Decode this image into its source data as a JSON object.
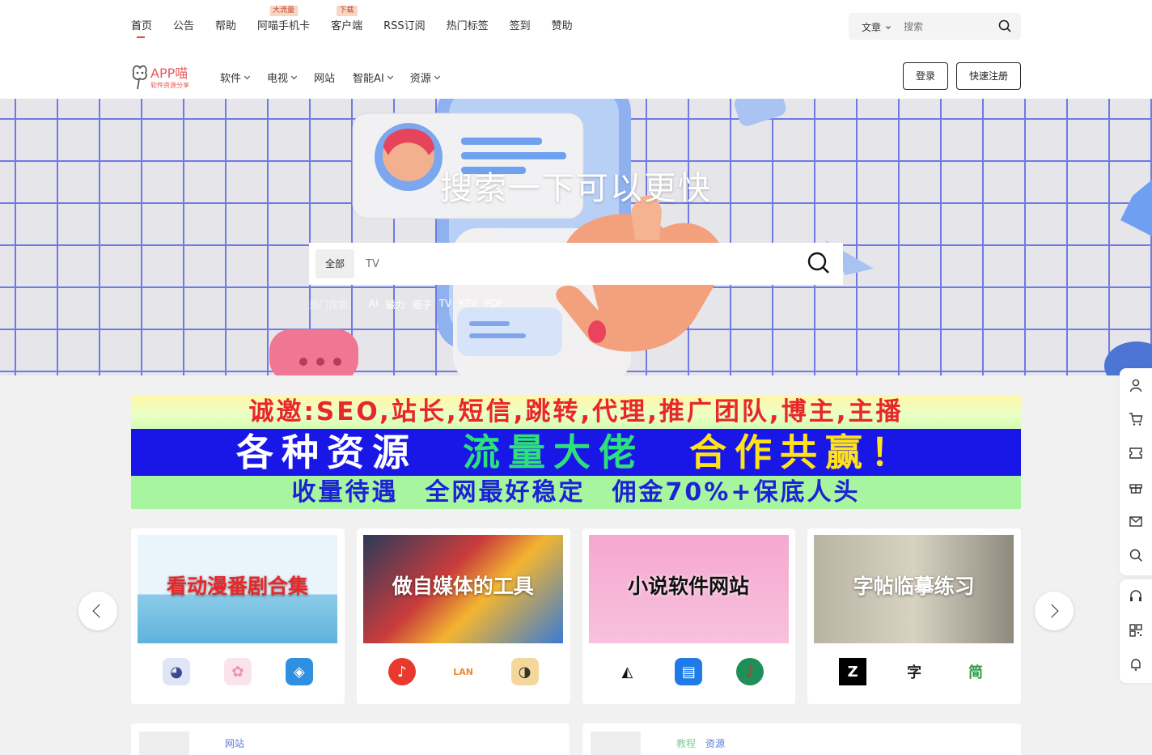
{
  "topnav": {
    "items": [
      {
        "label": "首页",
        "badge": ""
      },
      {
        "label": "公告",
        "badge": ""
      },
      {
        "label": "帮助",
        "badge": ""
      },
      {
        "label": "阿喵手机卡",
        "badge": "大流量"
      },
      {
        "label": "客户端",
        "badge": "下载"
      },
      {
        "label": "RSS订阅",
        "badge": ""
      },
      {
        "label": "热门标签",
        "badge": ""
      },
      {
        "label": "签到",
        "badge": ""
      },
      {
        "label": "赞助",
        "badge": ""
      }
    ],
    "search": {
      "category": "文章",
      "placeholder": "搜索"
    }
  },
  "logo": {
    "text": "APP喵",
    "tagline": "软件资源分享"
  },
  "mainnav": {
    "items": [
      "软件",
      "电视",
      "网站",
      "智能AI",
      "资源"
    ]
  },
  "auth": {
    "login": "登录",
    "register": "快速注册"
  },
  "hero": {
    "title": "搜索一下可以更快",
    "category": "全部",
    "placeholder": "TV",
    "hot_label": "热门搜索：",
    "hot_tags": [
      "AI",
      "磁力",
      "圈子",
      "TV",
      "KTV",
      "PDF"
    ]
  },
  "banner": {
    "line1": "诚邀:SEO,站长,短信,跳转,代理,推广团队,博主,主播",
    "line2a": "各种资源",
    "line2b": "流量大佬",
    "line2c": "合作共赢！",
    "line3": "收量待遇　全网最好稳定　佣金70%+保底人头"
  },
  "cards": [
    {
      "caption": "看动漫番剧合集",
      "icons": [
        {
          "glyph": "◕",
          "color": "#3b4a8f"
        },
        {
          "glyph": "✿",
          "color": "#f4a9c0"
        },
        {
          "glyph": "◈",
          "color": "#2f8fe0"
        }
      ]
    },
    {
      "caption": "做自媒体的工具",
      "icons": [
        {
          "glyph": "♪",
          "color": "#e8392f"
        },
        {
          "glyph": "LAN",
          "color": "#ffffff"
        },
        {
          "glyph": "◑",
          "color": "#e9c77a"
        }
      ]
    },
    {
      "caption": "小说软件网站",
      "icons": [
        {
          "glyph": "◭",
          "color": "#ffffff"
        },
        {
          "glyph": "▤",
          "color": "#1f7be8"
        },
        {
          "glyph": "♪",
          "color": "#d92a2a"
        }
      ]
    },
    {
      "caption": "字帖临摹练习",
      "icons": [
        {
          "glyph": "Z",
          "color": "#000000"
        },
        {
          "glyph": "字",
          "color": "#ffffff"
        },
        {
          "glyph": "简",
          "color": "#ffffff"
        }
      ]
    }
  ],
  "bottom": {
    "left_tag": "网站",
    "right_tag1": "教程",
    "right_tag2": "资源"
  }
}
